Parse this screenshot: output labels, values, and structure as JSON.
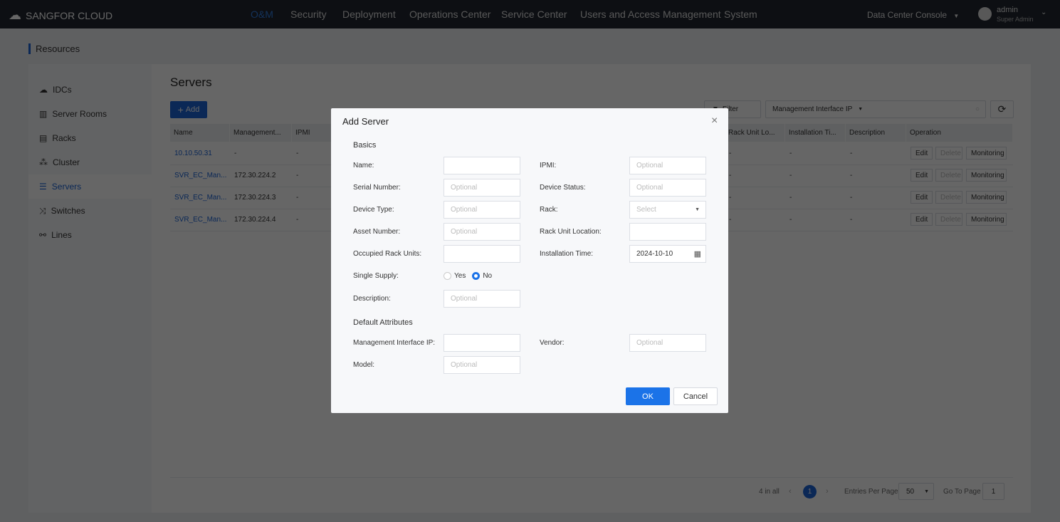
{
  "header": {
    "logo": "SANGFOR CLOUD",
    "nav": [
      "O&M",
      "Security",
      "Deployment",
      "Operations Center",
      "Service Center",
      "Users and Access Management",
      "System"
    ],
    "active_nav": "O&M",
    "console": "Data Center Console",
    "user": "admin",
    "role": "Super Admin"
  },
  "breadcrumb": "Resources",
  "sidebar": {
    "items": [
      {
        "label": "IDCs",
        "icon": "cloud-icon"
      },
      {
        "label": "Server Rooms",
        "icon": "building-icon"
      },
      {
        "label": "Racks",
        "icon": "rack-icon"
      },
      {
        "label": "Cluster",
        "icon": "cluster-icon"
      },
      {
        "label": "Servers",
        "icon": "server-icon"
      },
      {
        "label": "Switches",
        "icon": "shuffle-icon"
      },
      {
        "label": "Lines",
        "icon": "lines-icon"
      }
    ],
    "active": "Servers"
  },
  "main": {
    "title": "Servers",
    "add_label": "Add",
    "filter_label": "Filter",
    "search_field": "Management Interface IP",
    "columns": [
      "Name",
      "Management...",
      "IPMI",
      "Rack Unit Lo...",
      "Installation Ti...",
      "Description",
      "Operation"
    ],
    "rows": [
      {
        "name": "10.10.50.31",
        "mgmt": "-",
        "ipmi": "-",
        "rack_unit": "-",
        "install": "-",
        "desc": "-"
      },
      {
        "name": "SVR_EC_Man...",
        "mgmt": "172.30.224.2",
        "ipmi": "-",
        "rack_unit": "-",
        "install": "-",
        "desc": "-"
      },
      {
        "name": "SVR_EC_Man...",
        "mgmt": "172.30.224.3",
        "ipmi": "-",
        "rack_unit": "-",
        "install": "-",
        "desc": "-"
      },
      {
        "name": "SVR_EC_Man...",
        "mgmt": "172.30.224.4",
        "ipmi": "-",
        "rack_unit": "-",
        "install": "-",
        "desc": "-"
      }
    ],
    "ops": {
      "edit": "Edit",
      "delete": "Delete",
      "monitoring": "Monitoring"
    },
    "pagination": {
      "total": "4 in all",
      "page": "1",
      "entries_label": "Entries Per Page",
      "entries": "50",
      "goto_label": "Go To Page",
      "goto": "1"
    }
  },
  "modal": {
    "title": "Add Server",
    "basics": "Basics",
    "default_attributes": "Default Attributes",
    "fields": {
      "name": {
        "label": "Name:",
        "value": ""
      },
      "serial": {
        "label": "Serial Number:",
        "placeholder": "Optional"
      },
      "device_type": {
        "label": "Device Type:",
        "placeholder": "Optional"
      },
      "asset": {
        "label": "Asset Number:",
        "placeholder": "Optional"
      },
      "occupied": {
        "label": "Occupied Rack Units:",
        "value": ""
      },
      "single_supply": {
        "label": "Single Supply:",
        "yes": "Yes",
        "no": "No",
        "selected": "No"
      },
      "description": {
        "label": "Description:",
        "placeholder": "Optional"
      },
      "ipmi": {
        "label": "IPMI:",
        "placeholder": "Optional"
      },
      "status": {
        "label": "Device Status:",
        "placeholder": "Optional"
      },
      "rack": {
        "label": "Rack:",
        "placeholder": "Select"
      },
      "rack_unit": {
        "label": "Rack Unit Location:",
        "value": ""
      },
      "install_time": {
        "label": "Installation Time:",
        "value": "2024-10-10"
      },
      "mgmt_ip": {
        "label": "Management Interface IP:",
        "value": ""
      },
      "vendor": {
        "label": "Vendor:",
        "placeholder": "Optional"
      },
      "model": {
        "label": "Model:",
        "placeholder": "Optional"
      }
    },
    "ok": "OK",
    "cancel": "Cancel"
  }
}
